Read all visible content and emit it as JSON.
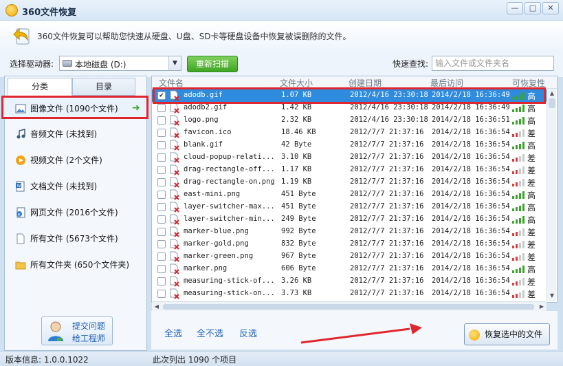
{
  "window": {
    "title": "360文件恢复",
    "min_icon": "minimize-icon",
    "max_icon": "maximize-icon",
    "close_icon": "close-icon",
    "min_glyph": "—",
    "max_glyph": "□",
    "close_glyph": "✕"
  },
  "description": "360文件恢复可以帮助您快速从硬盘、U盘、SD卡等硬盘设备中恢复被误删除的文件。",
  "toolbar": {
    "drive_label": "选择驱动器:",
    "drive_value": "本地磁盘 (D:)",
    "rescan_label": "重新扫描",
    "quick_search_label": "快速查找:",
    "search_placeholder": "输入文件或文件夹名",
    "search_value": ""
  },
  "left": {
    "tabs": [
      "分类",
      "目录"
    ],
    "categories": [
      {
        "label": "图像文件 (1090个文件)",
        "icon": "image-icon"
      },
      {
        "label": "音频文件 (未找到)",
        "icon": "music-icon"
      },
      {
        "label": "视频文件 (2个文件)",
        "icon": "video-icon"
      },
      {
        "label": "文档文件 (未找到)",
        "icon": "document-icon"
      },
      {
        "label": "网页文件 (2016个文件)",
        "icon": "webpage-icon"
      },
      {
        "label": "所有文件 (5673个文件)",
        "icon": "file-icon"
      },
      {
        "label": "所有文件夹 (650个文件夹)",
        "icon": "folder-icon"
      }
    ],
    "help_line1": "提交问题",
    "help_line2": "给工程师"
  },
  "table": {
    "headers": {
      "name": "文件名",
      "size": "文件大小",
      "created": "创建日期",
      "accessed": "最后访问",
      "recoverability": "可恢复性"
    },
    "rows": [
      {
        "checked": true,
        "name": "adodb.gif",
        "size": "1.07 KB",
        "created": "2012/4/16 23:30:18",
        "accessed": "2014/2/18 16:36:49",
        "rec": "高",
        "level": "high"
      },
      {
        "checked": false,
        "name": "adodb2.gif",
        "size": "1.42 KB",
        "created": "2012/4/16 23:30:18",
        "accessed": "2014/2/18 16:36:49",
        "rec": "高",
        "level": "high"
      },
      {
        "checked": false,
        "name": "logo.png",
        "size": "2.32 KB",
        "created": "2012/4/16 23:30:18",
        "accessed": "2014/2/18 16:36:51",
        "rec": "高",
        "level": "high"
      },
      {
        "checked": false,
        "name": "favicon.ico",
        "size": "18.46 KB",
        "created": "2012/7/7 21:37:16",
        "accessed": "2014/2/18 16:36:54",
        "rec": "差",
        "level": "low"
      },
      {
        "checked": false,
        "name": "blank.gif",
        "size": "42 Byte",
        "created": "2012/7/7 21:37:16",
        "accessed": "2014/2/18 16:36:54",
        "rec": "高",
        "level": "high"
      },
      {
        "checked": false,
        "name": "cloud-popup-relati...",
        "size": "3.10 KB",
        "created": "2012/7/7 21:37:16",
        "accessed": "2014/2/18 16:36:54",
        "rec": "差",
        "level": "low"
      },
      {
        "checked": false,
        "name": "drag-rectangle-off...",
        "size": "1.17 KB",
        "created": "2012/7/7 21:37:16",
        "accessed": "2014/2/18 16:36:54",
        "rec": "差",
        "level": "low"
      },
      {
        "checked": false,
        "name": "drag-rectangle-on.png",
        "size": "1.19 KB",
        "created": "2012/7/7 21:37:16",
        "accessed": "2014/2/18 16:36:54",
        "rec": "差",
        "level": "low"
      },
      {
        "checked": false,
        "name": "east-mini.png",
        "size": "451 Byte",
        "created": "2012/7/7 21:37:16",
        "accessed": "2014/2/18 16:36:54",
        "rec": "高",
        "level": "high"
      },
      {
        "checked": false,
        "name": "layer-switcher-max...",
        "size": "451 Byte",
        "created": "2012/7/7 21:37:16",
        "accessed": "2014/2/18 16:36:54",
        "rec": "高",
        "level": "high"
      },
      {
        "checked": false,
        "name": "layer-switcher-min...",
        "size": "249 Byte",
        "created": "2012/7/7 21:37:16",
        "accessed": "2014/2/18 16:36:54",
        "rec": "高",
        "level": "high"
      },
      {
        "checked": false,
        "name": "marker-blue.png",
        "size": "992 Byte",
        "created": "2012/7/7 21:37:16",
        "accessed": "2014/2/18 16:36:54",
        "rec": "差",
        "level": "low"
      },
      {
        "checked": false,
        "name": "marker-gold.png",
        "size": "832 Byte",
        "created": "2012/7/7 21:37:16",
        "accessed": "2014/2/18 16:36:54",
        "rec": "差",
        "level": "low"
      },
      {
        "checked": false,
        "name": "marker-green.png",
        "size": "967 Byte",
        "created": "2012/7/7 21:37:16",
        "accessed": "2014/2/18 16:36:54",
        "rec": "差",
        "level": "low"
      },
      {
        "checked": false,
        "name": "marker.png",
        "size": "606 Byte",
        "created": "2012/7/7 21:37:16",
        "accessed": "2014/2/18 16:36:54",
        "rec": "高",
        "level": "high"
      },
      {
        "checked": false,
        "name": "measuring-stick-of...",
        "size": "3.26 KB",
        "created": "2012/7/7 21:37:16",
        "accessed": "2014/2/18 16:36:54",
        "rec": "差",
        "level": "low"
      },
      {
        "checked": false,
        "name": "measuring-stick-on...",
        "size": "3.73 KB",
        "created": "2012/7/7 21:37:16",
        "accessed": "2014/2/18 16:36:54",
        "rec": "差",
        "level": "low"
      }
    ]
  },
  "actions": {
    "select_all": "全选",
    "select_none": "全不选",
    "invert": "反选",
    "recover": "恢复选中的文件"
  },
  "status": {
    "version": "版本信息: 1.0.0.1022",
    "count": "此次列出 1090 个项目"
  },
  "colors": {
    "accent": "#2f8bdd",
    "highlight": "#e0262e",
    "good": "#3aa52a",
    "bad": "#e23b3b"
  }
}
